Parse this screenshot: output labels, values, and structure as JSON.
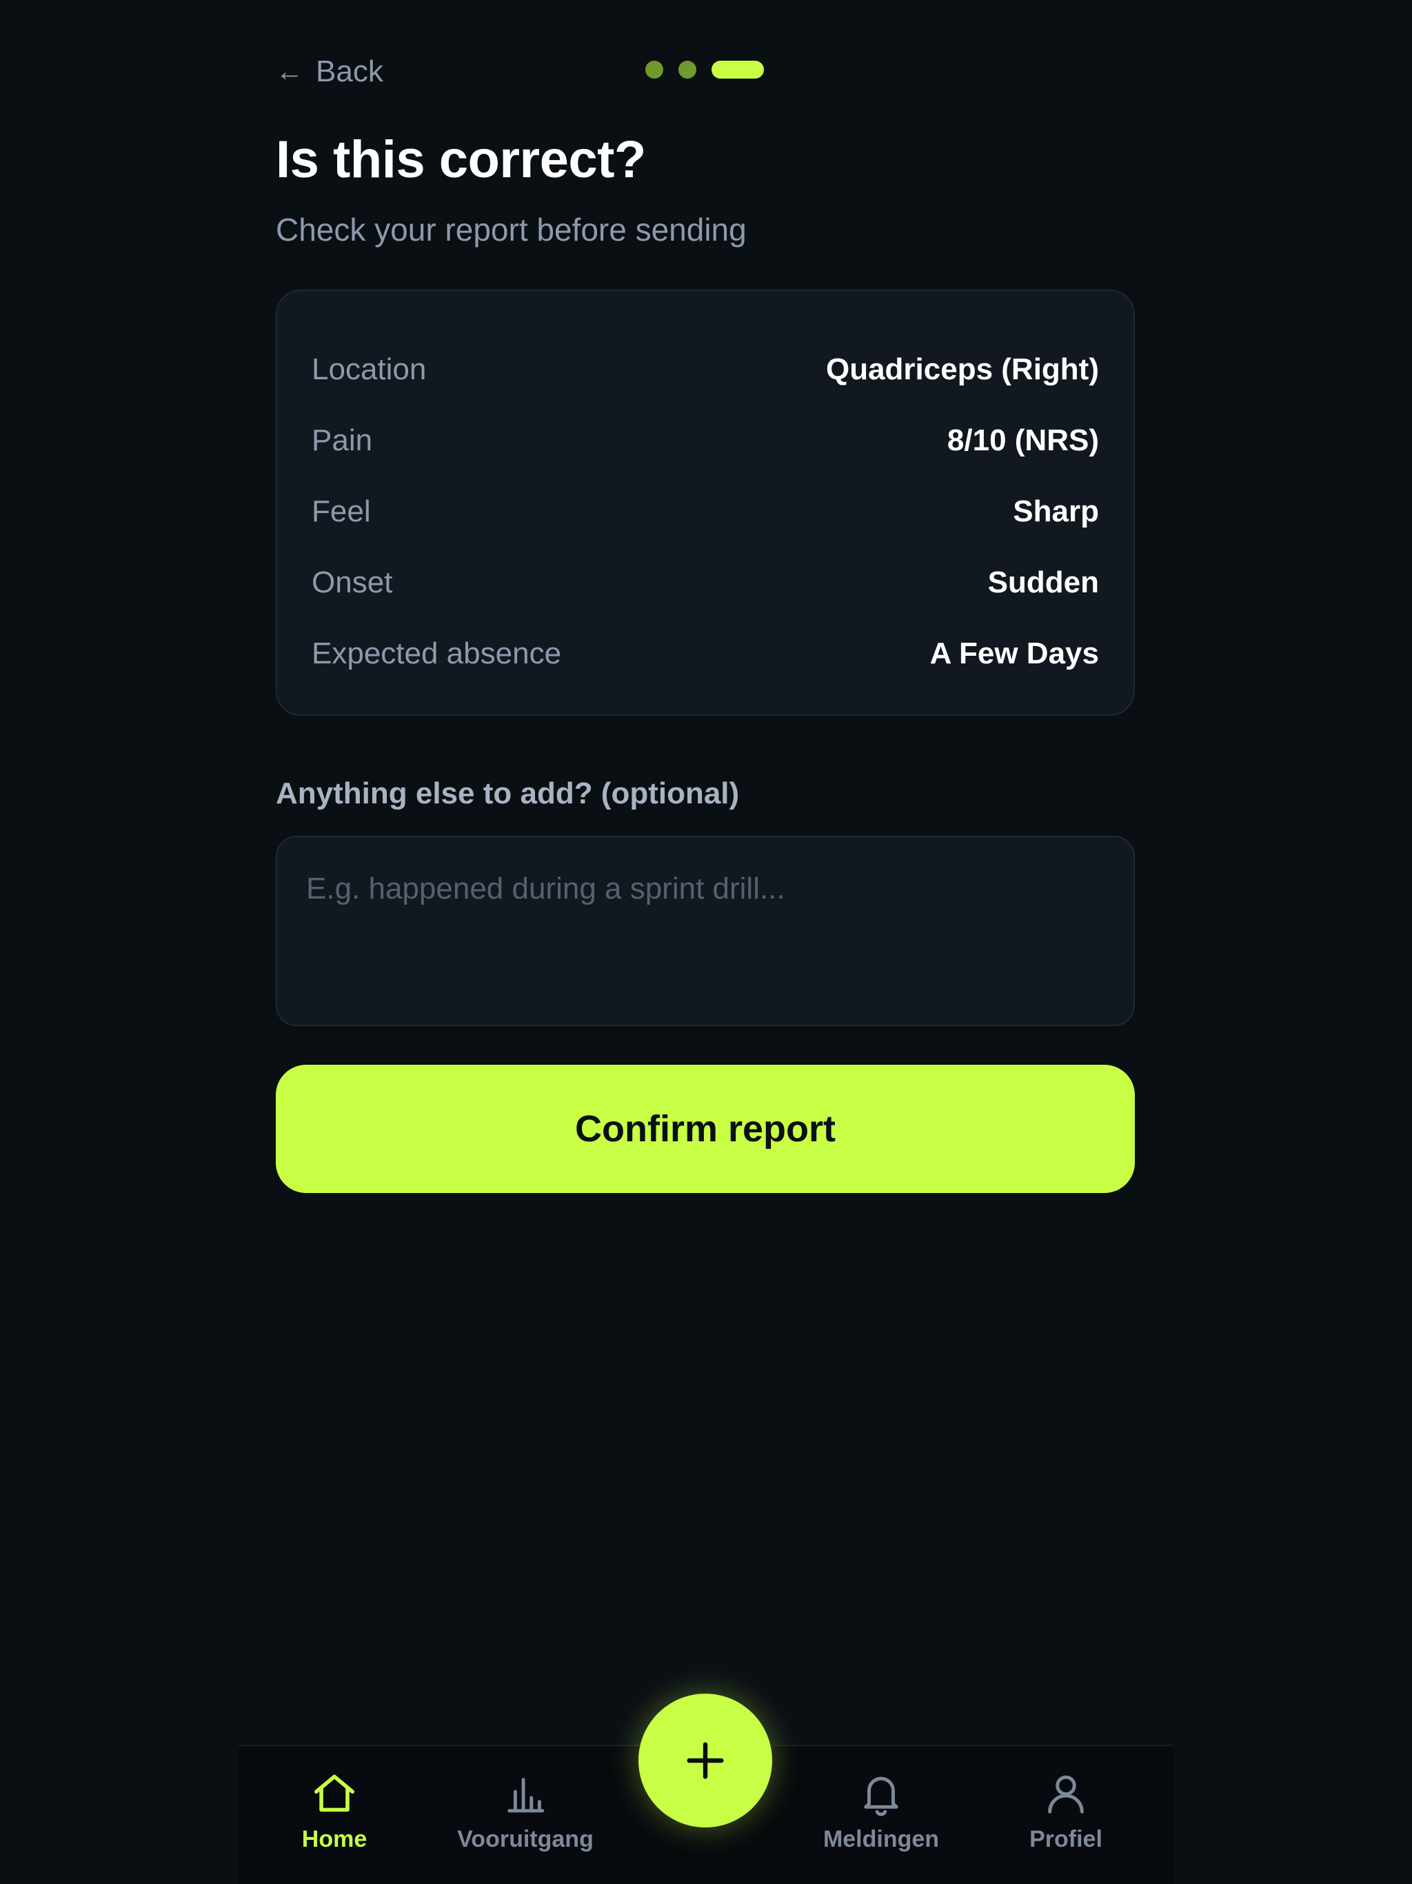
{
  "header": {
    "back_label": "Back",
    "back_arrow": "←",
    "progress": {
      "total_steps": 3,
      "current_step": 3,
      "colors": {
        "done": "#6f9a2c",
        "current": "#c8ff45"
      }
    }
  },
  "title": "Is this correct?",
  "subtitle": "Check your report before sending",
  "summary": {
    "rows": [
      {
        "label": "Location",
        "value": "Quadriceps (Right)"
      },
      {
        "label": "Pain",
        "value": "8/10 (NRS)"
      },
      {
        "label": "Feel",
        "value": "Sharp"
      },
      {
        "label": "Onset",
        "value": "Sudden"
      },
      {
        "label": "Expected absence",
        "value": "A Few Days"
      }
    ]
  },
  "notes": {
    "label": "Anything else to add? (optional)",
    "value": "",
    "placeholder": "E.g. happened during a sprint drill..."
  },
  "confirm_label": "Confirm report",
  "tabbar": {
    "items": [
      {
        "label": "Home",
        "icon": "home-icon",
        "active": true
      },
      {
        "label": "Vooruitgang",
        "icon": "bar-chart-icon",
        "active": false
      },
      {
        "label": "Meldingen",
        "icon": "bell-icon",
        "active": false
      },
      {
        "label": "Profiel",
        "icon": "user-icon",
        "active": false
      }
    ],
    "fab_icon": "plus-icon"
  },
  "colors": {
    "accent": "#c8ff45",
    "background": "#0a0f14",
    "card": "#121820",
    "muted_text": "#8d9aab"
  }
}
